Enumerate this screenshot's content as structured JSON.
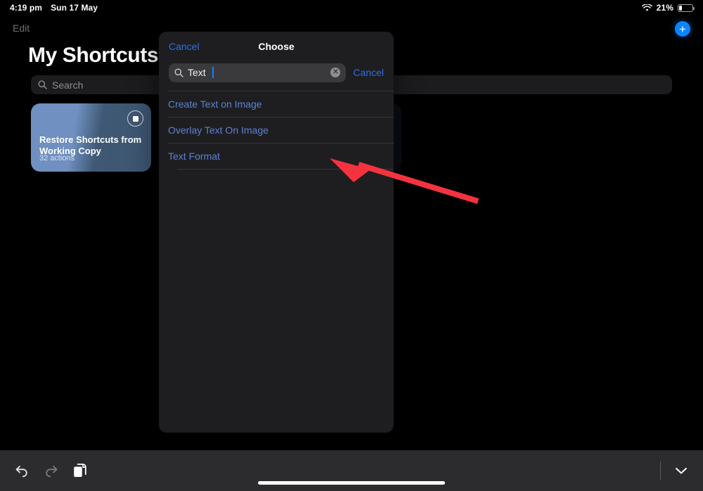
{
  "status_bar": {
    "time": "4:19 pm",
    "date": "Sun 17 May",
    "wifi_icon": "wifi-icon",
    "battery_percent": "21%",
    "battery_level": 21,
    "battery_icon": "battery-icon"
  },
  "app": {
    "edit_label": "Edit",
    "title": "My Shortcuts",
    "add_label": "+",
    "add_icon": "plus-icon",
    "search": {
      "placeholder": "Search",
      "icon": "search-icon",
      "value": ""
    },
    "shortcut_card": {
      "title": "Restore Shortcuts from Working Copy",
      "subtitle": "32 actions",
      "run_icon": "stop-square-icon"
    }
  },
  "modal": {
    "cancel_label": "Cancel",
    "title": "Choose",
    "search": {
      "icon": "search-icon",
      "value": "Text",
      "clear_icon": "clear-circle-icon",
      "clear_label": "✕",
      "cancel_label": "Cancel"
    },
    "results": [
      {
        "label": "Create Text on Image"
      },
      {
        "label": "Overlay Text On Image"
      },
      {
        "label": "Text Format"
      }
    ]
  },
  "annotation": {
    "arrow_icon": "red-arrow-pointer",
    "color": "#f5333f",
    "points_at": "Text Format"
  },
  "toolbar": {
    "undo_icon": "undo-arrow-icon",
    "redo_icon": "redo-arrow-icon",
    "paste_icon": "paste-documents-icon",
    "dismiss_icon": "chevron-down-icon"
  },
  "colors": {
    "accent_blue": "#0a84ff",
    "link_blue": "#2f6fe0",
    "row_blue": "#5b82d6",
    "modal_bg": "#1e1e20",
    "toolbar_bg": "#2c2c2e",
    "annotation_red": "#f5333f"
  }
}
